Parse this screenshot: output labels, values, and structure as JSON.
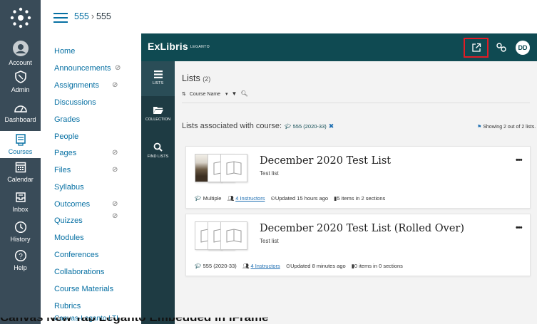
{
  "global_nav": {
    "items": [
      {
        "label": "Account",
        "icon": "account-icon"
      },
      {
        "label": "Admin",
        "icon": "admin-icon"
      },
      {
        "label": "Dashboard",
        "icon": "dashboard-icon"
      },
      {
        "label": "Courses",
        "icon": "courses-icon"
      },
      {
        "label": "Calendar",
        "icon": "calendar-icon"
      },
      {
        "label": "Inbox",
        "icon": "inbox-icon"
      },
      {
        "label": "History",
        "icon": "history-icon"
      },
      {
        "label": "Help",
        "icon": "help-icon"
      }
    ],
    "active": "Courses"
  },
  "breadcrumb": {
    "course": "555",
    "separator": "›",
    "current": "555"
  },
  "course_nav": {
    "items": [
      {
        "label": "Home",
        "hidden": false
      },
      {
        "label": "Announcements",
        "hidden": true
      },
      {
        "label": "Assignments",
        "hidden": true
      },
      {
        "label": "Discussions",
        "hidden": false
      },
      {
        "label": "Grades",
        "hidden": false
      },
      {
        "label": "People",
        "hidden": false
      },
      {
        "label": "Pages",
        "hidden": true
      },
      {
        "label": "Files",
        "hidden": true
      },
      {
        "label": "Syllabus",
        "hidden": false
      },
      {
        "label": "Outcomes",
        "hidden": true
      },
      {
        "label": "Quizzes",
        "hidden": true
      },
      {
        "label": "Modules",
        "hidden": false
      },
      {
        "label": "Conferences",
        "hidden": false
      },
      {
        "label": "Collaborations",
        "hidden": false
      },
      {
        "label": "Course Materials",
        "hidden": false
      },
      {
        "label": "Rubrics",
        "hidden": false
      },
      {
        "label": "Canvas-Leganto LTI",
        "hidden": false
      }
    ],
    "hidden_icon": "⊘"
  },
  "lti": {
    "logo": "ExLibris",
    "logo_sub": "LEGANTO",
    "avatar": "DD",
    "side": {
      "lists": "LISTS",
      "collection": "COLLECTION",
      "find_lists": "FIND LISTS"
    },
    "lists_title": "Lists",
    "lists_count": "(2)",
    "toolbar": {
      "sort_label": "Course Name"
    },
    "associated_label": "Lists associated with course:",
    "associated_course": "555 (2020-33)",
    "showing": "Showing 2 out of 2 lists.",
    "cards": [
      {
        "title": "December 2020 Test List",
        "description": "Test list",
        "course": "Multiple",
        "instructors": "4 Instructors",
        "updated": "Updated 15 hours ago",
        "items": "5 items in 2 sections"
      },
      {
        "title": "December 2020 Test List (Rolled Over)",
        "description": "Test list",
        "course": "555 (2020-33)",
        "instructors": "4 Instructors",
        "updated": "Updated 8 minutes ago",
        "items": "0 items in 0 sections"
      }
    ]
  },
  "bottom_caption": "Canvas New Tab Leganto Embedded in iFrame",
  "colors": {
    "global_nav_bg": "#394b58",
    "link": "#0770a3",
    "lti_header": "#0f4a52",
    "lti_side": "#1e3b43",
    "highlight_box": "#e21b25"
  }
}
